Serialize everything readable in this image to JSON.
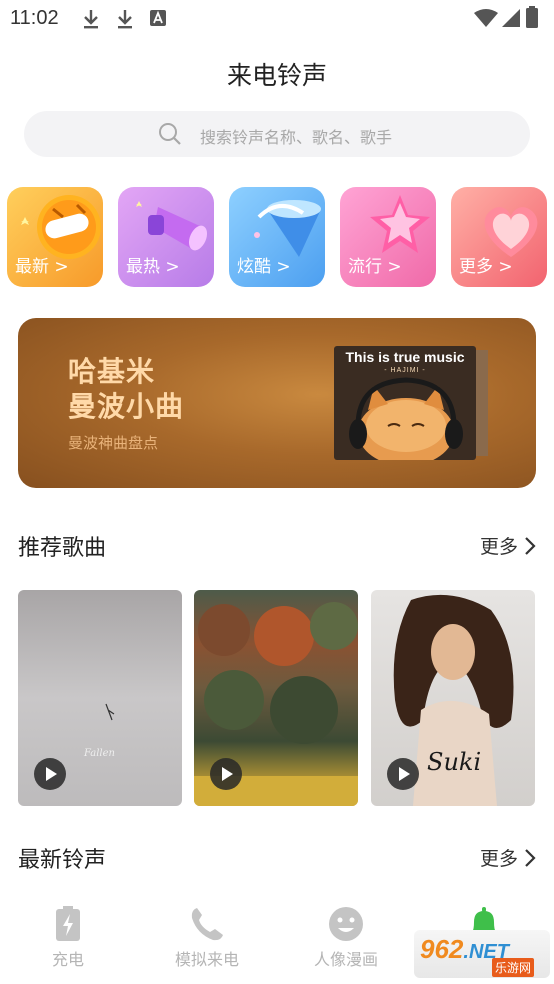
{
  "status_bar": {
    "time": "11:02"
  },
  "header": {
    "title": "来电铃声"
  },
  "search": {
    "placeholder": "搜索铃声名称、歌名、歌手"
  },
  "categories": [
    {
      "label": "最新 >",
      "color": "#f8b03a"
    },
    {
      "label": "最热 >",
      "color": "#c58ce8"
    },
    {
      "label": "炫酷 >",
      "color": "#5fb6f2"
    },
    {
      "label": "流行 >",
      "color": "#f07ab4"
    },
    {
      "label": "更多 >",
      "color": "#f7747c"
    }
  ],
  "banner": {
    "title_line1": "哈基米",
    "title_line2": "曼波小曲",
    "subtitle": "曼波神曲盘点",
    "card_title": "This is true music",
    "card_subtitle": "- HAJIMI -"
  },
  "recommended": {
    "title": "推荐歌曲",
    "more": "更多",
    "items": [
      {
        "icon": "play-icon"
      },
      {
        "icon": "play-icon"
      },
      {
        "icon": "play-icon"
      }
    ]
  },
  "latest": {
    "title": "最新铃声",
    "more": "更多"
  },
  "tabbar": {
    "tabs": [
      {
        "label": "充电",
        "icon": "battery-charge-icon"
      },
      {
        "label": "模拟来电",
        "icon": "phone-icon"
      },
      {
        "label": "人像漫画",
        "icon": "smile-face-icon"
      },
      {
        "label": "",
        "icon": "bell-icon"
      }
    ]
  },
  "watermark": {
    "main": "962",
    "suffix": ".NET",
    "sub": "乐游网"
  }
}
